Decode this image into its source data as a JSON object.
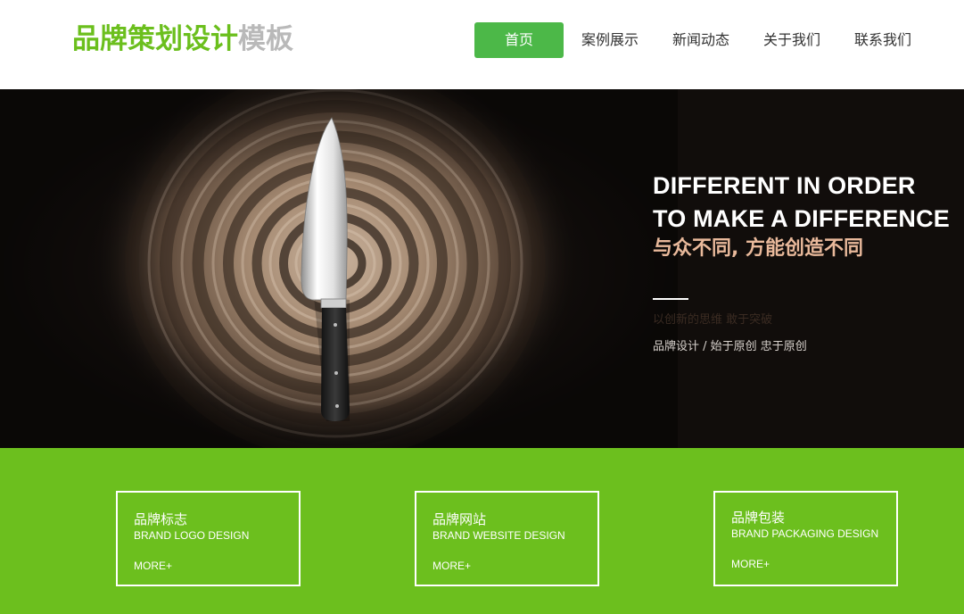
{
  "header": {
    "logo_primary": "品牌策划设计",
    "logo_secondary": "模板",
    "colors": {
      "logo_green": "#6bbf1d",
      "logo_gray": "#b9b9b9",
      "active_nav": "#4cb848"
    },
    "nav": [
      {
        "label": "首页",
        "active": true
      },
      {
        "label": "案例展示",
        "active": false
      },
      {
        "label": "新闻动态",
        "active": false
      },
      {
        "label": "关于我们",
        "active": false
      },
      {
        "label": "联系我们",
        "active": false
      }
    ]
  },
  "banner": {
    "headline_line1": "DIFFERENT IN ORDER",
    "headline_line2": "TO MAKE A DIFFERENCE",
    "subheadline": "与众不同, 方能创造不同",
    "faint_text": "以创新的思维 敢于突破",
    "tagline": "品牌设计 / 始于原创 忠于原创",
    "colors": {
      "background": "#110d0b",
      "subheadline": "#e9b99b"
    }
  },
  "services": {
    "background": "#6cbf1e",
    "items": [
      {
        "title": "品牌标志",
        "subtitle": "BRAND LOGO DESIGN",
        "more": "MORE+"
      },
      {
        "title": "品牌网站",
        "subtitle": "BRAND WEBSITE DESIGN",
        "more": "MORE+"
      },
      {
        "title": "品牌包装",
        "subtitle": "BRAND PACKAGING DESIGN",
        "more": "MORE+"
      }
    ]
  }
}
